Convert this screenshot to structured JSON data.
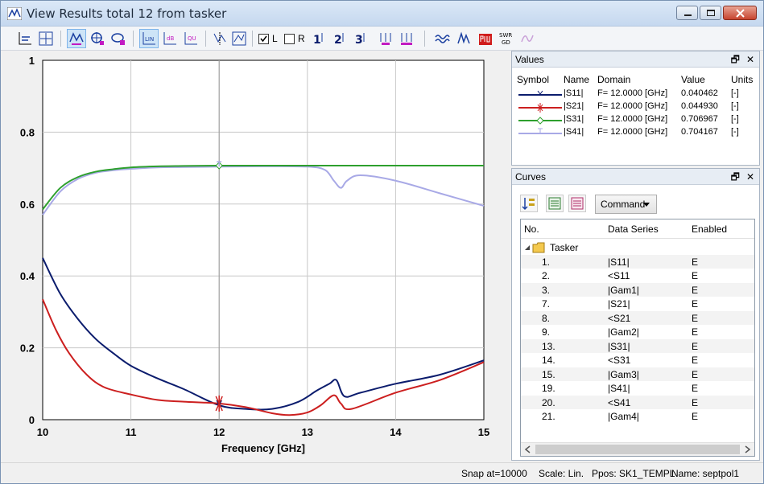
{
  "window": {
    "title": "View Results total 12 from tasker"
  },
  "toolbar": {
    "check_l": "L",
    "check_r": "R",
    "icons": [
      "axis-icon",
      "fit-icon",
      "wave-icon",
      "marker-icon",
      "zoom-icon",
      "lin-icon",
      "db-icon",
      "qu-icon",
      "marker-add-icon",
      "marker-table-icon",
      "one-icon",
      "two-icon",
      "three-icon",
      "tg-icon",
      "def-icon",
      "wave-view-icon",
      "pulse-icon",
      "pow-icon",
      "swr-gd-icon",
      "extra-icon"
    ],
    "btn_lin": "LIN",
    "btn_db": "dB",
    "btn_qu": "QU",
    "btn_1": "1",
    "btn_2": "2",
    "btn_3": "3",
    "btn_swr": "SWR",
    "btn_gd": "GD"
  },
  "chart_data": {
    "type": "line",
    "xlabel": "Frequency [GHz]",
    "ylabel": "",
    "xlim": [
      10,
      15
    ],
    "ylim": [
      0,
      1
    ],
    "xticks": [
      "10",
      "11",
      "12",
      "13",
      "14",
      "15"
    ],
    "yticks": [
      "0",
      "0.2",
      "0.4",
      "0.6",
      "0.8",
      "1"
    ],
    "grid": true,
    "marker_x": 12,
    "series": [
      {
        "name": "|S11|",
        "color": "#0b1c6d",
        "x": [
          10,
          10.2,
          10.4,
          10.6,
          10.8,
          11,
          11.3,
          11.6,
          12,
          12.3,
          12.6,
          12.9,
          13.1,
          13.25,
          13.33,
          13.42,
          13.6,
          14,
          14.5,
          15
        ],
        "y": [
          0.45,
          0.35,
          0.28,
          0.225,
          0.185,
          0.15,
          0.115,
          0.085,
          0.04,
          0.03,
          0.03,
          0.05,
          0.08,
          0.1,
          0.11,
          0.065,
          0.075,
          0.1,
          0.125,
          0.165
        ]
      },
      {
        "name": "|S21|",
        "color": "#cc1f1f",
        "x": [
          10,
          10.15,
          10.3,
          10.5,
          10.7,
          11,
          11.3,
          11.6,
          12,
          12.3,
          12.6,
          12.8,
          13,
          13.15,
          13.3,
          13.38,
          13.5,
          14,
          14.5,
          15
        ],
        "y": [
          0.335,
          0.25,
          0.185,
          0.125,
          0.09,
          0.07,
          0.055,
          0.05,
          0.045,
          0.035,
          0.018,
          0.013,
          0.02,
          0.04,
          0.068,
          0.045,
          0.03,
          0.075,
          0.11,
          0.16
        ]
      },
      {
        "name": "|S31|",
        "color": "#2ea02e",
        "x": [
          10,
          10.2,
          10.4,
          10.6,
          10.8,
          11,
          11.3,
          11.6,
          12,
          12.5,
          13,
          14,
          15
        ],
        "y": [
          0.585,
          0.645,
          0.675,
          0.69,
          0.697,
          0.702,
          0.705,
          0.706,
          0.707,
          0.707,
          0.707,
          0.707,
          0.707
        ]
      },
      {
        "name": "|S41|",
        "color": "#a8a9e6",
        "x": [
          10,
          10.2,
          10.4,
          10.6,
          10.8,
          11,
          11.3,
          11.6,
          12,
          12.5,
          13,
          13.2,
          13.3,
          13.38,
          13.45,
          13.6,
          14,
          14.5,
          15
        ],
        "y": [
          0.57,
          0.635,
          0.67,
          0.687,
          0.694,
          0.698,
          0.702,
          0.703,
          0.704,
          0.705,
          0.704,
          0.695,
          0.665,
          0.645,
          0.665,
          0.68,
          0.665,
          0.63,
          0.595
        ]
      }
    ]
  },
  "values_panel": {
    "title": "Values",
    "headers": {
      "symbol": "Symbol",
      "name": "Name",
      "domain": "Domain",
      "value": "Value",
      "units": "Units"
    },
    "rows": [
      {
        "name": "|S11|",
        "domain": "F= 12.0000 [GHz]",
        "value": "0.040462",
        "units": "[-]",
        "color": "#0b1c6d"
      },
      {
        "name": "|S21|",
        "domain": "F= 12.0000 [GHz]",
        "value": "0.044930",
        "units": "[-]",
        "color": "#cc1f1f"
      },
      {
        "name": "|S31|",
        "domain": "F= 12.0000 [GHz]",
        "value": "0.706967",
        "units": "[-]",
        "color": "#2ea02e"
      },
      {
        "name": "|S41|",
        "domain": "F= 12.0000 [GHz]",
        "value": "0.704167",
        "units": "[-]",
        "color": "#a8a9e6"
      }
    ]
  },
  "curves_panel": {
    "title": "Curves",
    "command_label": "Command",
    "headers": {
      "no": "No.",
      "series": "Data Series",
      "enabled": "Enabled"
    },
    "group": "Tasker",
    "rows": [
      {
        "no": "1.",
        "series": "|S11|",
        "enabled": "E"
      },
      {
        "no": "2.",
        "series": "<S11",
        "enabled": "E"
      },
      {
        "no": "3.",
        "series": "|Gam1|",
        "enabled": "E"
      },
      {
        "no": "7.",
        "series": "|S21|",
        "enabled": "E"
      },
      {
        "no": "8.",
        "series": "<S21",
        "enabled": "E"
      },
      {
        "no": "9.",
        "series": "|Gam2|",
        "enabled": "E"
      },
      {
        "no": "13.",
        "series": "|S31|",
        "enabled": "E"
      },
      {
        "no": "14.",
        "series": "<S31",
        "enabled": "E"
      },
      {
        "no": "15.",
        "series": "|Gam3|",
        "enabled": "E"
      },
      {
        "no": "19.",
        "series": "|S41|",
        "enabled": "E"
      },
      {
        "no": "20.",
        "series": "<S41",
        "enabled": "E"
      },
      {
        "no": "21.",
        "series": "|Gam4|",
        "enabled": "E"
      }
    ]
  },
  "status": {
    "snap": "Snap at=10000",
    "scale": "Scale: Lin.",
    "ppos": "Ppos: SK1_TEMPL",
    "name": "Name: septpol1"
  }
}
